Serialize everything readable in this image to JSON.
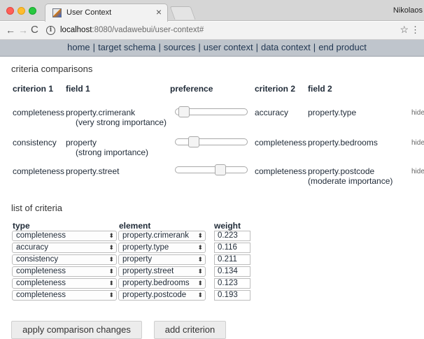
{
  "browser": {
    "tab_title": "User Context",
    "tab_close": "×",
    "profile_name": "Nikolaos",
    "url_host": "localhost",
    "url_rest": ":8080/vadawebui/user-context#",
    "back": "←",
    "forward": "→",
    "reload": "C",
    "info": "i",
    "star": "☆",
    "menu": "⋮"
  },
  "nav": {
    "items": [
      "home",
      "target schema",
      "sources",
      "user context",
      "data context",
      "end product"
    ],
    "separator": "|"
  },
  "comparisons": {
    "title": "criteria comparisons",
    "headers": {
      "criterion1": "criterion 1",
      "field1": "field 1",
      "preference": "preference",
      "criterion2": "criterion 2",
      "field2": "field 2"
    },
    "rows": [
      {
        "criterion1": "completeness",
        "field1": "property.crimerank",
        "note1": "(very strong importance)",
        "preference": 0.12,
        "criterion2": "accuracy",
        "field2": "property.type",
        "note2": "",
        "hide": "hide"
      },
      {
        "criterion1": "consistency",
        "field1": "property",
        "note1": "(strong importance)",
        "preference": 0.25,
        "criterion2": "completeness",
        "field2": "property.bedrooms",
        "note2": "",
        "hide": "hide"
      },
      {
        "criterion1": "completeness",
        "field1": "property.street",
        "note1": "",
        "preference": 0.63,
        "criterion2": "completeness",
        "field2": "property.postcode",
        "note2": "(moderate importance)",
        "hide": "hide"
      }
    ]
  },
  "criteria": {
    "title": "list of criteria",
    "headers": {
      "type": "type",
      "element": "element",
      "weight": "weight"
    },
    "rows": [
      {
        "type": "completeness",
        "element": "property.crimerank",
        "weight": "0.223"
      },
      {
        "type": "accuracy",
        "element": "property.type",
        "weight": "0.116"
      },
      {
        "type": "consistency",
        "element": "property",
        "weight": "0.211"
      },
      {
        "type": "completeness",
        "element": "property.street",
        "weight": "0.134"
      },
      {
        "type": "completeness",
        "element": "property.bedrooms",
        "weight": "0.123"
      },
      {
        "type": "completeness",
        "element": "property.postcode",
        "weight": "0.193"
      }
    ],
    "select_arrow": "⬍"
  },
  "actions": {
    "apply": "apply comparison changes",
    "add": "add criterion"
  },
  "colors": {
    "navbar_bg": "#bfc5cc",
    "text": "#1f2a37"
  }
}
